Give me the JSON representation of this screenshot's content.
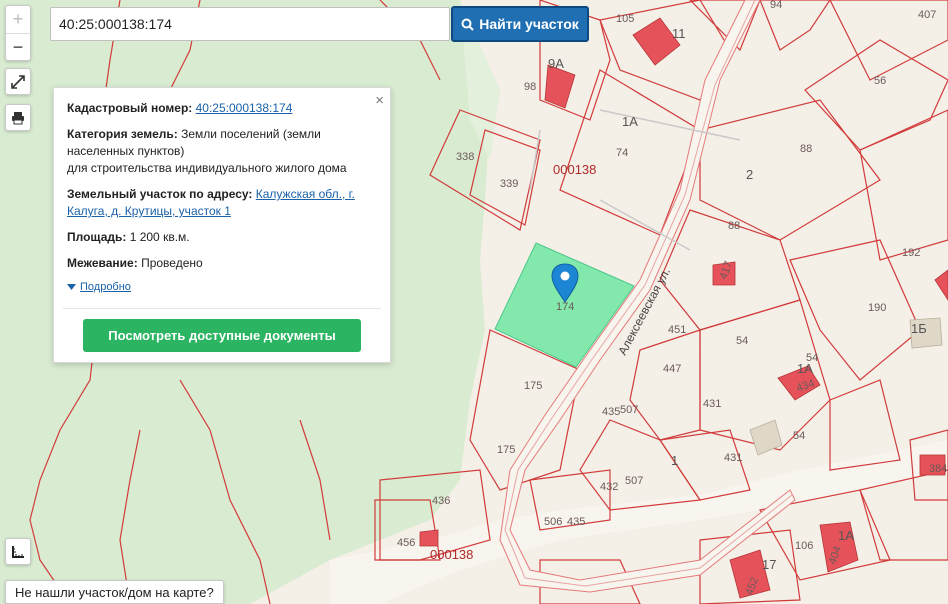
{
  "search": {
    "value": "40:25:000138:174",
    "button_label": "Найти участок"
  },
  "controls": {
    "zoom_in": "+",
    "zoom_out": "−"
  },
  "popup": {
    "close": "×",
    "cadastral_label": "Кадастровый номер:",
    "cadastral_value": "40:25:000138:174",
    "category_label": "Категория земель:",
    "category_value_1": "Земли поселений (земли населенных пунктов)",
    "category_value_2": "для строительства индивидуального жилого дома",
    "address_label": "Земельный участок по адресу:",
    "address_value": "Калужская обл., г. Калуга, д. Крутицы, участок 1",
    "area_label": "Площадь:",
    "area_value": "1 200 кв.м.",
    "survey_label": "Межевание:",
    "survey_value": "Проведено",
    "more_label": "Подробно",
    "docs_button": "Посмотреть доступные документы"
  },
  "not_found": "Не нашли участок/дом на карте?",
  "map": {
    "street": "Алексеевская ул.",
    "block_labels": [
      "000138",
      "000138"
    ],
    "parcel_labels": [
      "105",
      "11",
      "94",
      "407",
      "9А",
      "98",
      "1А",
      "74",
      "56",
      "338",
      "339",
      "88",
      "2",
      "88",
      "192",
      "190",
      "1Б",
      "174",
      "417",
      "451",
      "54",
      "54",
      "1А",
      "434",
      "447",
      "175",
      "435",
      "507",
      "431",
      "175",
      "431",
      "54",
      "1",
      "384",
      "432",
      "507",
      "506",
      "435",
      "436",
      "456",
      "106",
      "1А",
      "404",
      "17",
      "452"
    ],
    "colors": {
      "land": "#f4efe7",
      "forest": "#d7ebcf",
      "boundary": "#d23b3b",
      "building": "#e6525a",
      "selected": "#6ee6a0",
      "marker": "#1d86d4"
    }
  }
}
